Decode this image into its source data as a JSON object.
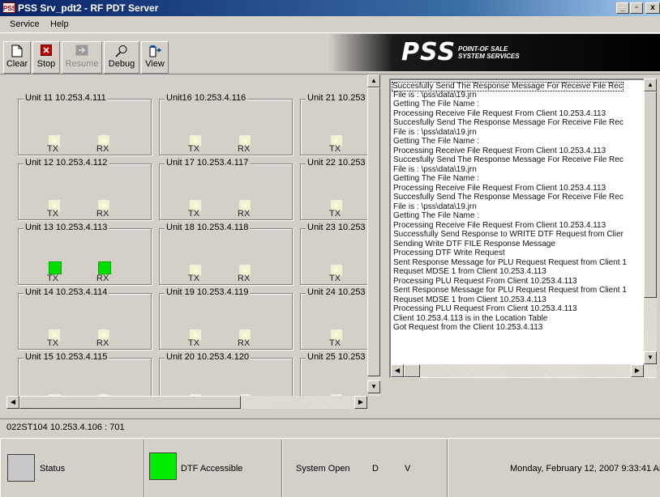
{
  "window": {
    "app_icon_text": "PSS",
    "title": "PSS Srv_pdt2  -  RF PDT Server",
    "minimize": "_",
    "maximize": "▫",
    "close": "x"
  },
  "menu": [
    "Service",
    "Help"
  ],
  "toolbar": {
    "buttons": [
      {
        "label": "Clear",
        "icon": "document-icon",
        "enabled": true
      },
      {
        "label": "Stop",
        "icon": "stop-icon",
        "enabled": true
      },
      {
        "label": "Resume",
        "icon": "resume-icon",
        "enabled": false
      },
      {
        "label": "Debug",
        "icon": "magnifier-icon",
        "enabled": true
      },
      {
        "label": "View",
        "icon": "view-icon",
        "enabled": true
      }
    ]
  },
  "banner": {
    "logo": "PSS",
    "tagline_1": "POINT-OF SALE",
    "tagline_2": "SYSTEM SERVICES"
  },
  "units": [
    {
      "name": "Unit 11  10.253.4.111",
      "tx": false,
      "rx": false
    },
    {
      "name": "Unit16  10.253.4.116",
      "tx": false,
      "rx": false
    },
    {
      "name": "Unit 21  10.253",
      "tx": false,
      "rx": null
    },
    {
      "name": "Unit 12  10.253.4.112",
      "tx": false,
      "rx": false
    },
    {
      "name": "Unit 17  10.253.4.117",
      "tx": false,
      "rx": false
    },
    {
      "name": "Unit 22  10.253",
      "tx": false,
      "rx": null
    },
    {
      "name": "Unit 13  10.253.4.113",
      "tx": true,
      "rx": true
    },
    {
      "name": "Unit 18  10.253.4.118",
      "tx": false,
      "rx": false
    },
    {
      "name": "Unit 23  10.253",
      "tx": false,
      "rx": null
    },
    {
      "name": "Unit 14  10.253.4.114",
      "tx": false,
      "rx": false
    },
    {
      "name": "Unit 19  10.253.4.119",
      "tx": false,
      "rx": false
    },
    {
      "name": "Unit 24  10.253",
      "tx": false,
      "rx": null
    },
    {
      "name": "Unit 15  10.253.4.115",
      "tx": false,
      "rx": false
    },
    {
      "name": "Unit 20  10.253.4.120",
      "tx": false,
      "rx": false
    },
    {
      "name": "Unit 25  10.253",
      "tx": false,
      "rx": null
    }
  ],
  "labels": {
    "tx": "TX",
    "rx": "RX"
  },
  "log": [
    "Succesfully Send The Response Message For Receive File Rec",
    "   File is : \\pss\\data\\19.jrn",
    "   Getting The File Name :",
    "   Processing Receive File Request From Client 10.253.4.113",
    "Succesfully Send The Response Message For Receive File Rec",
    "   File is : \\pss\\data\\19.jrn",
    "   Getting The File Name :",
    "   Processing Receive File Request From Client 10.253.4.113",
    "Succesfully Send The Response Message For Receive File Rec",
    "   File is : \\pss\\data\\19.jrn",
    "   Getting The File Name :",
    "   Processing Receive File Request From Client 10.253.4.113",
    "Succesfully Send The Response Message For Receive File Rec",
    "   File is : \\pss\\data\\19.jrn",
    "   Getting The File Name :",
    "   Processing Receive File Request From Client 10.253.4.113",
    "Successfully Send Response to WRITE DTF Request from Clier",
    "Sending Write DTF FILE Response Message",
    "   Processing DTF Write Request",
    "Sent Response Message for PLU Request Request from Client 1",
    "Requset MDSE 1 from Client 10.253.4.113",
    "   Processing PLU Request From Client 10.253.4.113",
    "Sent Response Message for PLU Request Request from Client 1",
    "Requset MDSE 1 from Client 10.253.4.113",
    "   Processing PLU Request From Client 10.253.4.113",
    "   Client    10.253.4.113 is in the Location Table",
    "   Got Request from the Client    10.253.4.113"
  ],
  "status_line": "022ST104 10.253.4.106 : 701",
  "status_bar": {
    "status_label": "Status",
    "dtf_label": "DTF Accessible",
    "system_open": "System Open",
    "flag_d": "D",
    "flag_v": "V",
    "datetime": "Monday, February 12, 2007 9:33:41 AM"
  },
  "colors": {
    "led_on": "#00dd00",
    "status_swatch": "#c8c8c8",
    "dtf_swatch": "#00ee00"
  }
}
